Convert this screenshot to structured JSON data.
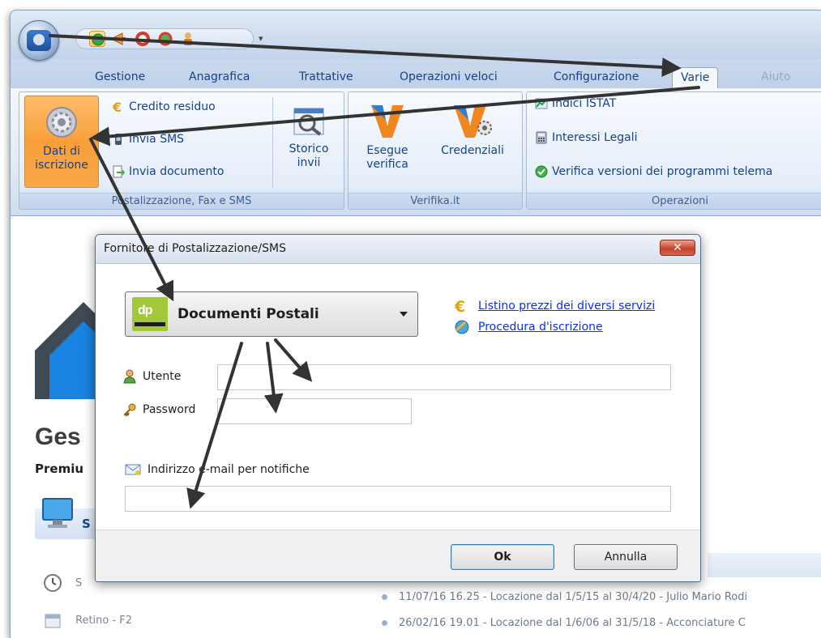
{
  "qat": {
    "dropdown_glyph": "▾"
  },
  "tabs": [
    {
      "label": "Gestione"
    },
    {
      "label": "Anagrafica"
    },
    {
      "label": "Trattative"
    },
    {
      "label": "Operazioni veloci"
    },
    {
      "label": "Configurazione"
    },
    {
      "label": "Varie",
      "active": true
    },
    {
      "label": "Aiuto",
      "disabled": true
    }
  ],
  "ribbon": {
    "group1": {
      "label": "Postalizzazione, Fax e SMS",
      "dati_iscrizione_line1": "Dati di",
      "dati_iscrizione_line2": "iscrizione",
      "credito_residuo": "Credito residuo",
      "invia_sms": "Invia SMS",
      "invia_documento": "Invia documento",
      "storico_line1": "Storico",
      "storico_line2": "invii"
    },
    "group2": {
      "label": "Verifika.it",
      "esegue_line1": "Esegue",
      "esegue_line2": "verifica",
      "credenziali": "Credenziali"
    },
    "group3": {
      "label": "Operazioni",
      "indici_istat": "Indici ISTAT",
      "interessi_legali": "Interessi Legali",
      "verifica_versioni": "Verifica versioni dei programmi telema"
    }
  },
  "background": {
    "brand": "Ges",
    "premium": "Premiu",
    "section_initial": "S",
    "item1_initial": "S",
    "item2": "Retino   - F2",
    "news": [
      "11/07/16 16.25 - Locazione dal 1/5/15 al 30/4/20 - Julio Mario Rodi",
      "26/02/16 19.01 - Locazione dal 1/6/06 al 31/5/18 - Acconciature C"
    ]
  },
  "dialog": {
    "title": "Fornitore di Postalizzazione/SMS",
    "close_glyph": "✕",
    "provider": {
      "logo_text": "dp",
      "selected": "Documenti Postali"
    },
    "links": {
      "listino": "Listino prezzi dei diversi servizi",
      "procedura": "Procedura d'iscrizione"
    },
    "fields": {
      "utente_label": "Utente",
      "utente_value": "",
      "password_label": "Password",
      "password_value": "",
      "email_label": "Indirizzo e-mail per notifiche",
      "email_value": ""
    },
    "buttons": {
      "ok": "Ok",
      "annulla": "Annulla"
    }
  },
  "colors": {
    "ribbon_text": "#15428b",
    "pressed_button": "#f99f39",
    "link": "#0b2ff0",
    "close_button": "#c7442c",
    "logo_green": "#a3c83a",
    "annotation_arrow": "#333333"
  },
  "icons": {
    "app_orb": "app-orb-icon",
    "dati_iscrizione": "gear-icon",
    "credito_residuo": "euro-icon",
    "invia_sms": "phone-icon",
    "invia_documento": "document-arrow-icon",
    "storico_invii": "magnifier-document-icon",
    "verifika": "verifika-v-icon",
    "credenziali": "verifika-gear-icon",
    "indici_istat": "chart-icon",
    "interessi_legali": "calculator-icon",
    "verifica_versioni": "check-circle-icon",
    "utente": "user-icon",
    "password": "key-icon",
    "email": "envelope-icon"
  }
}
